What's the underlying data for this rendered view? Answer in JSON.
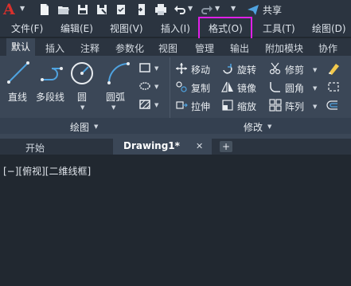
{
  "quick_access": {
    "logo": "A",
    "share_label": "共享",
    "icons": [
      "new-icon",
      "open-icon",
      "save-icon",
      "save-as-icon",
      "cloud-icon",
      "print-icon",
      "undo-icon",
      "redo-icon"
    ]
  },
  "menubar": {
    "items": [
      "文件(F)",
      "编辑(E)",
      "视图(V)",
      "插入(I)",
      "格式(O)",
      "工具(T)",
      "绘图(D)"
    ],
    "highlighted": "格式(O)",
    "highlight_color": "#e020e8"
  },
  "ribbon_tabs": [
    "默认",
    "插入",
    "注释",
    "参数化",
    "视图",
    "管理",
    "输出",
    "附加模块",
    "协作"
  ],
  "ribbon": {
    "draw_panel": {
      "tools": [
        "直线",
        "多段线",
        "圆",
        "圆弧"
      ],
      "footer": "绘图"
    },
    "modify_panel": {
      "rows": [
        [
          "移动",
          "旋转",
          "修剪"
        ],
        [
          "复制",
          "镜像",
          "圆角"
        ],
        [
          "拉伸",
          "缩放",
          "阵列"
        ]
      ],
      "footer": "修改"
    }
  },
  "doc_tabs": {
    "start": "开始",
    "current": "Drawing1*",
    "close": "✕",
    "add": "+"
  },
  "viewport": {
    "label": "[−][俯视][二维线框]"
  },
  "colors": {
    "background": "#212830",
    "panel": "#3b4757",
    "bar": "#2b3440",
    "accent_blue": "#4fa3e0",
    "logo_red": "#d9302c"
  }
}
